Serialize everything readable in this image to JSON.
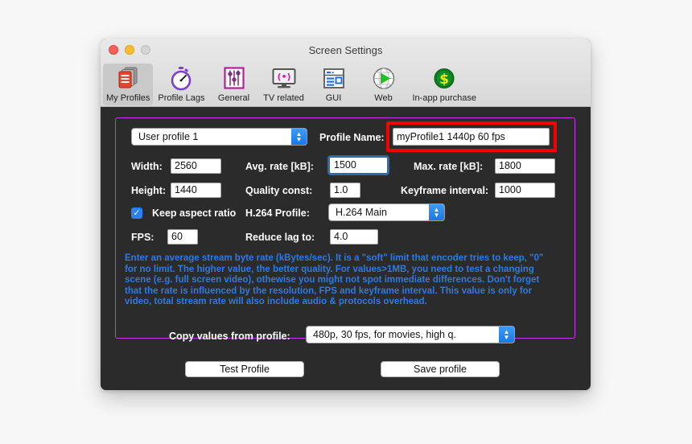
{
  "window": {
    "title": "Screen Settings",
    "controls": {
      "close": "close-button",
      "minimize": "minimize-button",
      "zoom": "zoom-button"
    }
  },
  "toolbar": {
    "items": [
      {
        "label": "My Profiles",
        "icon": "profiles-icon",
        "selected": true
      },
      {
        "label": "Profile Lags",
        "icon": "stopwatch-icon",
        "selected": false
      },
      {
        "label": "General",
        "icon": "sliders-icon",
        "selected": false
      },
      {
        "label": "TV related",
        "icon": "tv-icon",
        "selected": false
      },
      {
        "label": "GUI",
        "icon": "window-layout-icon",
        "selected": false
      },
      {
        "label": "Web",
        "icon": "play-globe-icon",
        "selected": false
      },
      {
        "label": "In-app purchase",
        "icon": "dollar-coin-icon",
        "selected": false
      }
    ]
  },
  "form": {
    "profile_select": {
      "value": "User profile 1",
      "options": [
        "User profile 1"
      ]
    },
    "profile_name": {
      "label": "Profile Name:",
      "value": "myProfile1 1440p 60 fps",
      "highlighted": true
    },
    "width": {
      "label": "Width:",
      "value": "2560"
    },
    "height": {
      "label": "Height:",
      "value": "1440"
    },
    "keep_aspect_ratio": {
      "label": "Keep aspect ratio",
      "checked": true,
      "check_glyph": "✓"
    },
    "fps": {
      "label": "FPS:",
      "value": "60"
    },
    "avg_rate": {
      "label": "Avg. rate [kB]:",
      "value": "1500",
      "focused": true
    },
    "quality_const": {
      "label": "Quality const:",
      "value": "1.0"
    },
    "h264_profile": {
      "label": "H.264 Profile:",
      "value": "H.264 Main",
      "options": [
        "H.264 Main"
      ]
    },
    "reduce_lag": {
      "label": "Reduce lag to:",
      "value": "4.0"
    },
    "max_rate": {
      "label": "Max. rate [kB]:",
      "value": "1800"
    },
    "keyframe_interval": {
      "label": "Keyframe interval:",
      "value": "1000"
    },
    "copy_values": {
      "label": "Copy values from profile:",
      "value": "480p, 30 fps, for movies, high q.",
      "options": [
        "480p, 30 fps, for movies, high q."
      ]
    }
  },
  "help_text": "Enter an average stream byte rate (kBytes/sec). It is a \"soft\" limit that encoder tries to keep, \"0\" for no limit. The higher value, the better quality. For values>1MB, you need to test a changing scene (e.g. full screen video), othewise you might not spot immediate differences. Don't forget that the rate is influenced by the resolution, FPS and keyframe interval. This value is only for video, total stream rate will also include audio & protocols overhead.",
  "buttons": {
    "test_profile": "Test Profile",
    "save_profile": "Save profile"
  },
  "colors": {
    "panel_border": "#cc33ee",
    "highlight_box": "#f40000",
    "help_text": "#2f7ae0",
    "focus_ring": "#2b6cab",
    "accent_blue": "#1878e8",
    "window_bg": "#2b2b2b"
  },
  "arrow_glyphs": {
    "up": "▲",
    "down": "▼"
  }
}
